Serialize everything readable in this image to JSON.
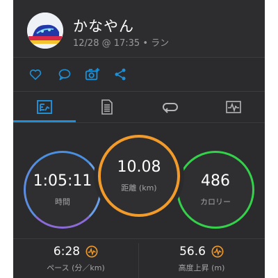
{
  "header": {
    "user_name": "かなやん",
    "activity_meta": "12/28 @ 17:35 • ラン"
  },
  "actions": [
    {
      "icon": "heart-icon"
    },
    {
      "icon": "comment-icon"
    },
    {
      "icon": "add-photo-icon"
    },
    {
      "icon": "share-icon"
    }
  ],
  "tabs": [
    {
      "icon": "summary-icon",
      "active": true
    },
    {
      "icon": "details-icon",
      "active": false
    },
    {
      "icon": "laps-icon",
      "active": false
    },
    {
      "icon": "charts-icon",
      "active": false
    }
  ],
  "stats": {
    "time": {
      "value": "1:05:11",
      "label": "時間"
    },
    "distance": {
      "value": "10.08",
      "label": "距離 (km)"
    },
    "calories": {
      "value": "486",
      "label": "カロリー"
    }
  },
  "bottom_stats": {
    "pace": {
      "value": "6:28",
      "label": "ペース (分／km)"
    },
    "elevation": {
      "value": "56.6",
      "label": "高度上昇 (m)"
    }
  },
  "colors": {
    "accent": "#1e8fd6",
    "distance_ring": "#f29b2a",
    "calories_ring": "#34d14a",
    "time_ring": "#4a90e2",
    "chart_badge": "#f29b2a"
  }
}
